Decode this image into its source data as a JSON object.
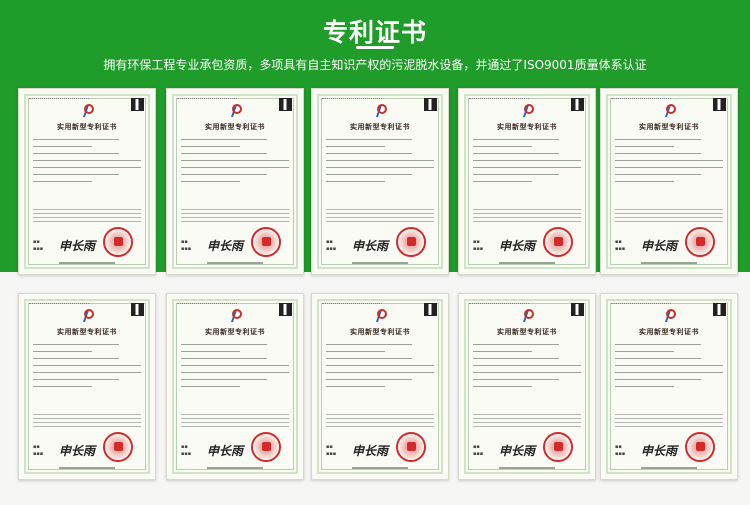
{
  "header": {
    "title": "专利证书",
    "subtitle": "拥有环保工程专业承包资质，多项具有自主知识产权的污泥脱水设备，并通过了ISO9001质量体系认证"
  },
  "certificate_title": "实用新型专利证书",
  "signature": "申长雨",
  "certificates": [
    {
      "id": 1
    },
    {
      "id": 2
    },
    {
      "id": 3
    },
    {
      "id": 4
    },
    {
      "id": 5
    },
    {
      "id": 6
    },
    {
      "id": 7
    },
    {
      "id": 8
    },
    {
      "id": 9
    },
    {
      "id": 10
    }
  ],
  "colors": {
    "banner": "#1f9c2a",
    "seal": "#d42a2a"
  }
}
